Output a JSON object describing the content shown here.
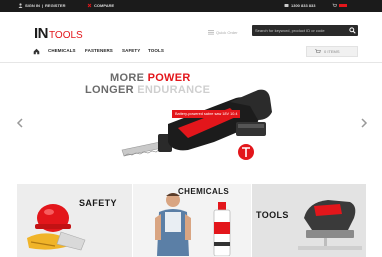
{
  "topbar": {
    "signin": "SIGN IN",
    "separator": "|",
    "register": "REGISTER",
    "compare": "COMPARE",
    "phone": "1300 833 833"
  },
  "logo": {
    "brand_a": "IN",
    "brand_b": "TOOLS"
  },
  "header": {
    "quick_order": "Quick Order",
    "search_placeholder": "Search for keyword, product ID or code"
  },
  "nav": {
    "items": [
      {
        "label": "CHEMICALS"
      },
      {
        "label": "FASTENERS"
      },
      {
        "label": "SAFETY"
      },
      {
        "label": "TOOLS"
      }
    ],
    "cart_label": "0 ITEMS"
  },
  "hero": {
    "line1_a": "MORE",
    "line1_b": "POWER",
    "line2_a": "LONGER",
    "line2_b": "ENDURANCE",
    "tag": "Battery-powered sabre saw 18V 10.4"
  },
  "tiles": [
    {
      "title": "SAFETY"
    },
    {
      "title": "CHEMICALS"
    },
    {
      "title": "TOOLS"
    }
  ],
  "colors": {
    "accent": "#e3161b",
    "dark": "#1b1b1b"
  }
}
